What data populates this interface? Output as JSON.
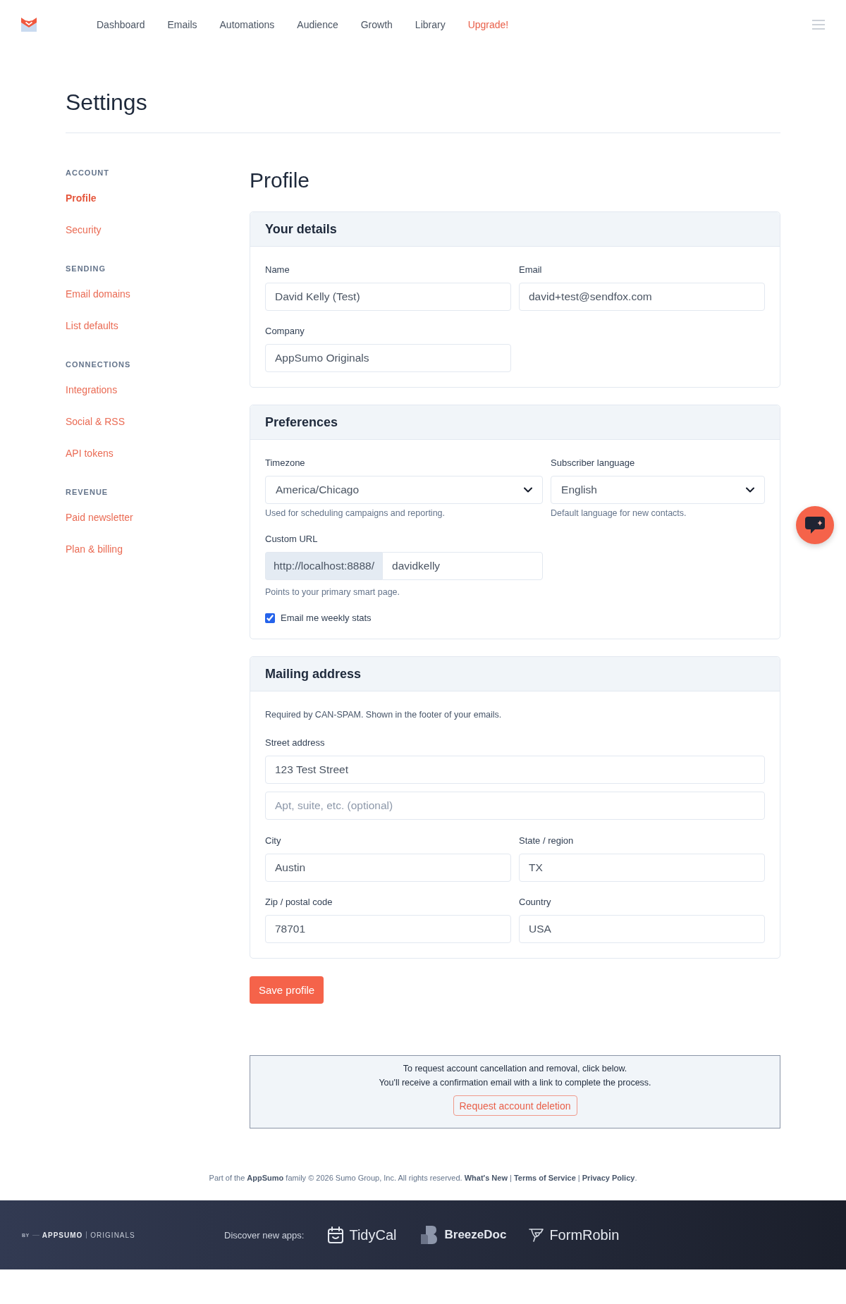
{
  "nav": {
    "items": [
      {
        "label": "Dashboard",
        "kind": "link"
      },
      {
        "label": "Emails",
        "kind": "link"
      },
      {
        "label": "Automations",
        "kind": "link"
      },
      {
        "label": "Audience",
        "kind": "link"
      },
      {
        "label": "Growth",
        "kind": "link"
      },
      {
        "label": "Library",
        "kind": "link"
      },
      {
        "label": "Upgrade!",
        "kind": "upgrade"
      }
    ]
  },
  "page": {
    "title": "Settings"
  },
  "sidebar": {
    "sections": [
      {
        "heading": "ACCOUNT",
        "items": [
          {
            "label": "Profile",
            "selected": true
          },
          {
            "label": "Security",
            "selected": false
          }
        ]
      },
      {
        "heading": "SENDING",
        "items": [
          {
            "label": "Email domains",
            "selected": false
          },
          {
            "label": "List defaults",
            "selected": false
          }
        ]
      },
      {
        "heading": "CONNECTIONS",
        "items": [
          {
            "label": "Integrations",
            "selected": false
          },
          {
            "label": "Social & RSS",
            "selected": false
          },
          {
            "label": "API tokens",
            "selected": false
          }
        ]
      },
      {
        "heading": "REVENUE",
        "items": [
          {
            "label": "Paid newsletter",
            "selected": false
          },
          {
            "label": "Plan & billing",
            "selected": false
          }
        ]
      }
    ]
  },
  "content": {
    "title": "Profile",
    "cards": [
      {
        "title": "Your details",
        "fields": [
          {
            "kind": "text",
            "label": "Name",
            "value": "David Kelly (Test)"
          },
          {
            "kind": "text",
            "label": "Email",
            "value": "david+test@sendfox.com"
          },
          {
            "kind": "text",
            "label": "Company",
            "value": "AppSumo Originals"
          }
        ]
      },
      {
        "title": "Preferences",
        "fields": [
          {
            "kind": "select",
            "label": "Timezone",
            "value": "America/Chicago",
            "help": "Used for scheduling campaigns and reporting."
          },
          {
            "kind": "select",
            "label": "Subscriber language",
            "value": "English",
            "help": "Default language for new contacts."
          },
          {
            "kind": "prefixed",
            "label": "Custom URL",
            "prefix": "http://localhost:8888/",
            "value": "davidkelly",
            "help": "Points to your primary smart page."
          },
          {
            "kind": "checkbox",
            "label": "Email me weekly stats",
            "checked": true
          }
        ]
      },
      {
        "title": "Mailing address",
        "note": "Required by CAN-SPAM. Shown in the footer of your emails.",
        "street": {
          "label": "Street address",
          "lines": [
            {
              "value": "123 Test Street"
            },
            {
              "placeholder": "Apt, suite, etc. (optional)"
            }
          ]
        },
        "fields": [
          {
            "kind": "text",
            "label": "City",
            "value": "Austin"
          },
          {
            "kind": "text",
            "label": "State / region",
            "value": "TX"
          },
          {
            "kind": "text",
            "label": "Zip / postal code",
            "value": "78701"
          },
          {
            "kind": "text",
            "label": "Country",
            "value": "USA"
          }
        ]
      }
    ],
    "save_button": "Save profile",
    "danger_zone": {
      "lines": [
        "To request account cancellation and removal, click below.",
        "You'll receive a confirmation email with a link to complete the process."
      ],
      "button": "Request account deletion"
    }
  },
  "footer_note": {
    "text": "Part of the **AppSumo** family © 2026 Sumo Group, Inc. All rights reserved.",
    "links": [
      "What's New",
      "Terms of Service",
      "Privacy Policy"
    ],
    "separator": "|",
    "end": "."
  },
  "footer": {
    "brand": {
      "prefix": "BY",
      "name": "APPSUMO",
      "suffix": "ORIGINALS"
    },
    "discover_label": "Discover new apps:",
    "apps": [
      {
        "name": "TidyCal",
        "kind": "calendar"
      },
      {
        "name": "BreezeDoc",
        "kind": "blocks"
      },
      {
        "name": "FormRobin",
        "kind": "bird"
      }
    ]
  }
}
